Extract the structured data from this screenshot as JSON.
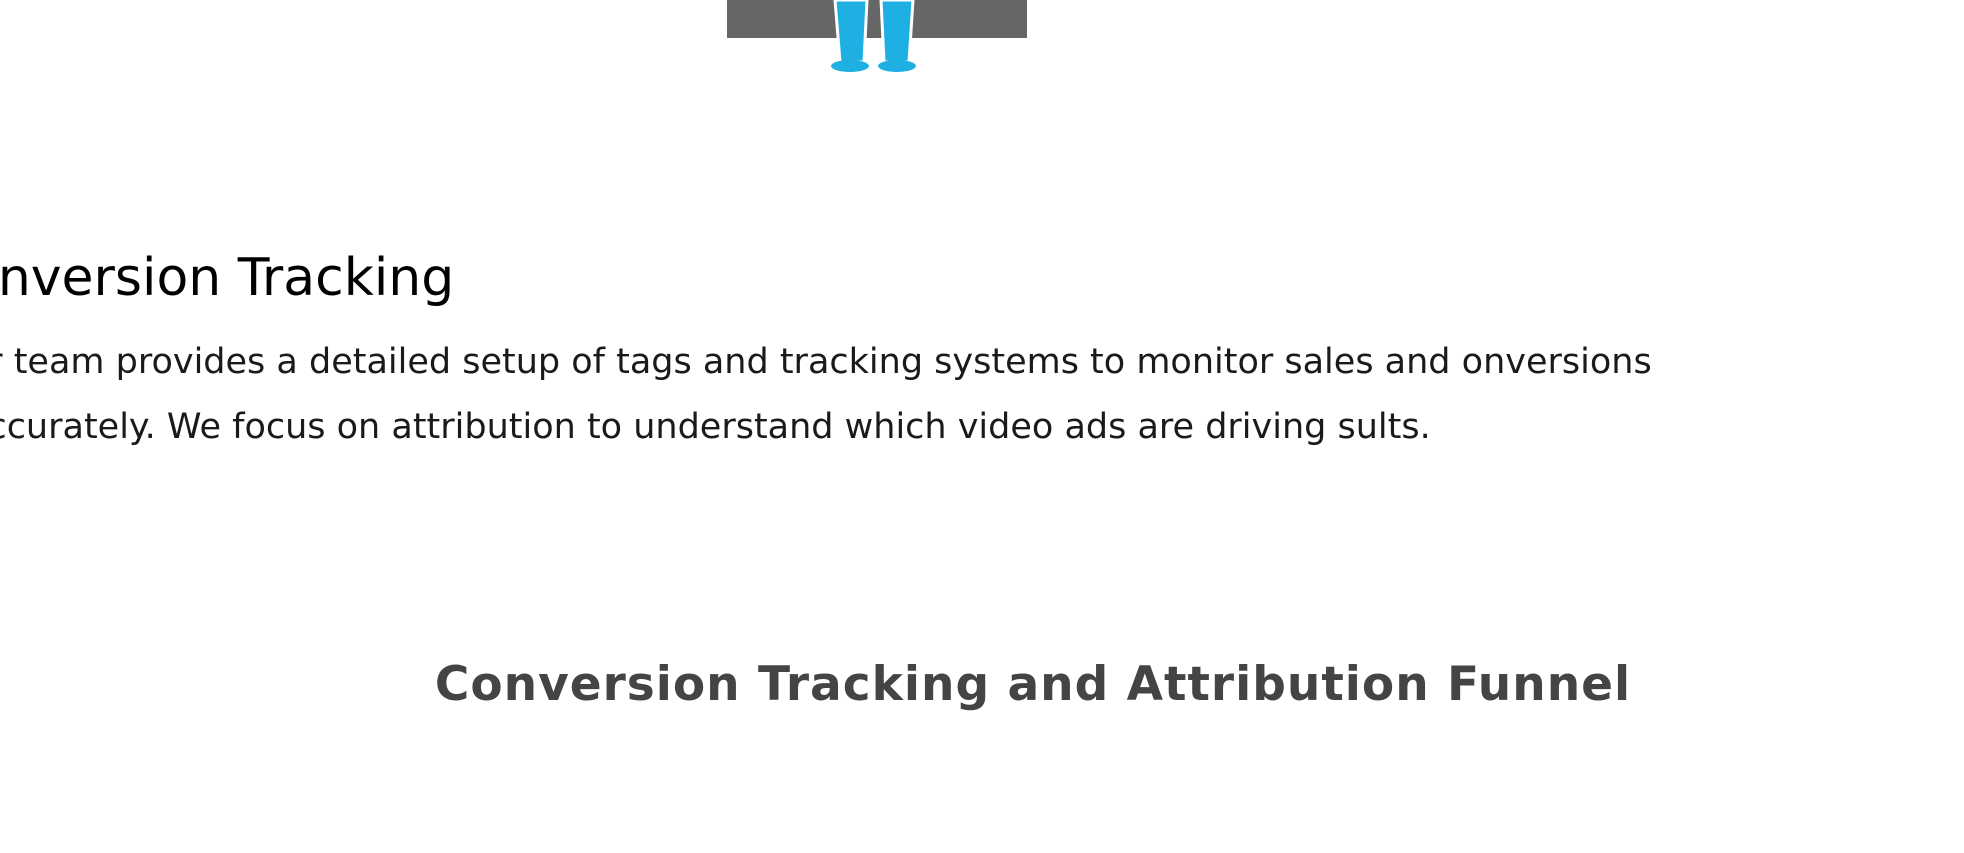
{
  "illustration": {
    "icon": "person-standing-at-desk-illustration",
    "colors": {
      "desk": "#666666",
      "legs": "#1fb0e3"
    }
  },
  "section": {
    "title": "onversion Tracking",
    "body": "ur team provides a detailed setup of tags and tracking systems to monitor sales and onversions accurately. We focus on attribution to understand which video ads are driving sults."
  },
  "funnel": {
    "title": "Conversion Tracking and Attribution Funnel"
  }
}
